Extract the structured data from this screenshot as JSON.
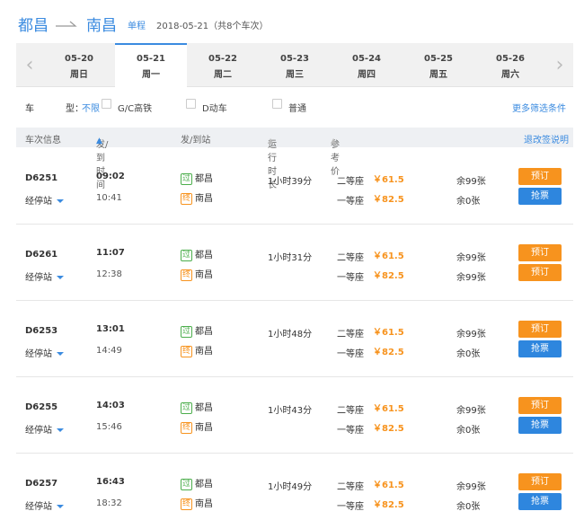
{
  "header": {
    "from": "都昌",
    "to": "南昌",
    "trip_type": "单程",
    "date_info": "2018-05-21（共8个车次）"
  },
  "dates": [
    {
      "date": "05-20",
      "weekday": "周日",
      "active": false
    },
    {
      "date": "05-21",
      "weekday": "周一",
      "active": true
    },
    {
      "date": "05-22",
      "weekday": "周二",
      "active": false
    },
    {
      "date": "05-23",
      "weekday": "周三",
      "active": false
    },
    {
      "date": "05-24",
      "weekday": "周四",
      "active": false
    },
    {
      "date": "05-25",
      "weekday": "周五",
      "active": false
    },
    {
      "date": "05-26",
      "weekday": "周六",
      "active": false
    }
  ],
  "filters": {
    "label": "车",
    "label2": "型：",
    "unlimited": "不限",
    "options": [
      "G/C高铁",
      "D动车",
      "普通"
    ],
    "more": "更多筛选条件"
  },
  "table_header": {
    "train_info": "车次信息",
    "depart_time": "发/到时间",
    "stations": "发/到站",
    "duration": "运行时长",
    "price": "参考价",
    "refund": "退改签说明"
  },
  "trains": [
    {
      "no": "D6251",
      "stops_label": "经停站",
      "dep": "09:02",
      "arr": "10:41",
      "pass_tag": "过",
      "end_tag": "终",
      "from": "都昌",
      "to": "南昌",
      "duration": "1小时39分",
      "seat1": "二等座",
      "price1": "￥61.5",
      "seat2": "一等座",
      "price2": "￥82.5",
      "remain1": "余99张",
      "remain2": "余0张",
      "btn1": "预订",
      "btn2": "抢票",
      "btn2_type": "grab"
    },
    {
      "no": "D6261",
      "stops_label": "经停站",
      "dep": "11:07",
      "arr": "12:38",
      "pass_tag": "过",
      "end_tag": "终",
      "from": "都昌",
      "to": "南昌",
      "duration": "1小时31分",
      "seat1": "二等座",
      "price1": "￥61.5",
      "seat2": "一等座",
      "price2": "￥82.5",
      "remain1": "余99张",
      "remain2": "余99张",
      "btn1": "预订",
      "btn2": "预订",
      "btn2_type": "book"
    },
    {
      "no": "D6253",
      "stops_label": "经停站",
      "dep": "13:01",
      "arr": "14:49",
      "pass_tag": "过",
      "end_tag": "终",
      "from": "都昌",
      "to": "南昌",
      "duration": "1小时48分",
      "seat1": "二等座",
      "price1": "￥61.5",
      "seat2": "一等座",
      "price2": "￥82.5",
      "remain1": "余99张",
      "remain2": "余0张",
      "btn1": "预订",
      "btn2": "抢票",
      "btn2_type": "grab"
    },
    {
      "no": "D6255",
      "stops_label": "经停站",
      "dep": "14:03",
      "arr": "15:46",
      "pass_tag": "过",
      "end_tag": "终",
      "from": "都昌",
      "to": "南昌",
      "duration": "1小时43分",
      "seat1": "二等座",
      "price1": "￥61.5",
      "seat2": "一等座",
      "price2": "￥82.5",
      "remain1": "余99张",
      "remain2": "余0张",
      "btn1": "预订",
      "btn2": "抢票",
      "btn2_type": "grab"
    },
    {
      "no": "D6257",
      "stops_label": "经停站",
      "dep": "16:43",
      "arr": "18:32",
      "pass_tag": "过",
      "end_tag": "终",
      "from": "都昌",
      "to": "南昌",
      "duration": "1小时49分",
      "seat1": "二等座",
      "price1": "￥61.5",
      "seat2": "一等座",
      "price2": "￥82.5",
      "remain1": "余99张",
      "remain2": "余0张",
      "btn1": "预订",
      "btn2": "抢票",
      "btn2_type": "grab"
    }
  ],
  "colors": {
    "accent": "#3b8be0",
    "orange": "#f7931e",
    "blue_button": "#2e86de",
    "pass_green": "#4cae4c"
  }
}
